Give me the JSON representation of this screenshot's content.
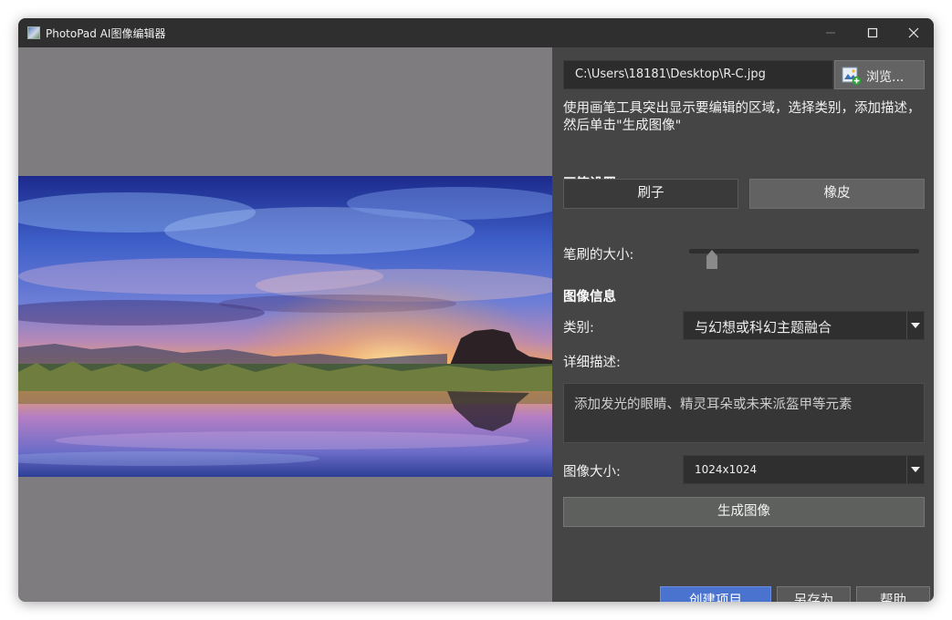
{
  "window": {
    "title": "PhotoPad AI图像编辑器"
  },
  "file": {
    "path": "C:\\Users\\18181\\Desktop\\R-C.jpg",
    "browse_label": "浏览..."
  },
  "instructions": "使用画笔工具突出显示要编辑的区域，选择类别，添加描述，然后单击\"生成图像\"",
  "brush_settings": {
    "title": "画笔设置",
    "brush_label": "刷子",
    "eraser_label": "橡皮",
    "size_label": "笔刷的大小:",
    "size_value_fraction": 0.1
  },
  "image_info": {
    "title": "图像信息",
    "category_label": "类别:",
    "category_value": "与幻想或科幻主题融合",
    "description_label": "详细描述:",
    "description_value": "添加发光的眼睛、精灵耳朵或未来派盔甲等元素",
    "size_label": "图像大小:",
    "size_value": "1024x1024"
  },
  "actions": {
    "generate_label": "生成图像",
    "create_label": "创建项目",
    "save_as_label": "另存为",
    "help_label": "帮助"
  },
  "icons": {
    "app": "photopad-app-icon",
    "minimize": "minimize-icon",
    "maximize": "maximize-icon",
    "close": "close-icon",
    "browse": "add-image-icon"
  },
  "colors": {
    "accent": "#4a73d0",
    "panel_bg": "#454545",
    "canvas_bg": "#7f7c80"
  }
}
